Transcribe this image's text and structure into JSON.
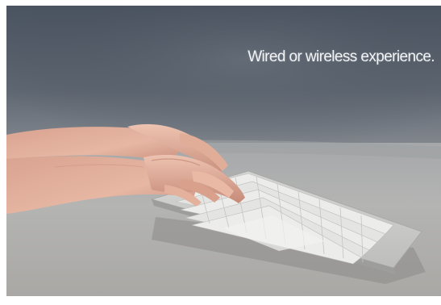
{
  "caption": "Wired or wireless experience."
}
